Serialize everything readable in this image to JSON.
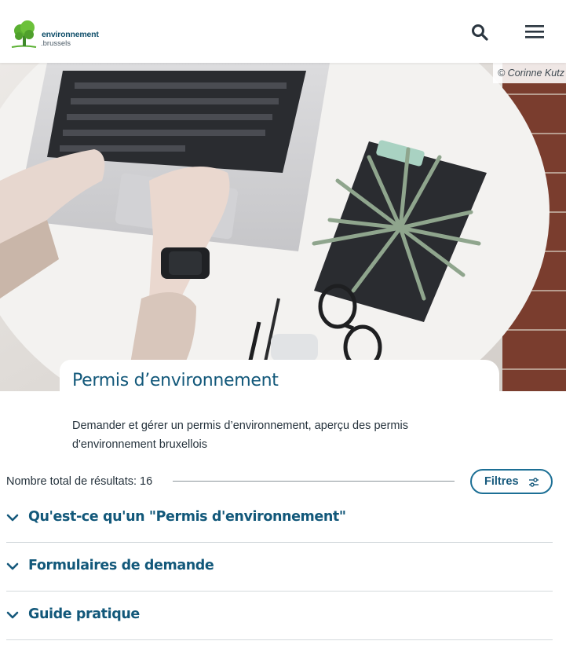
{
  "header": {
    "logo_line1": "environnement",
    "logo_line2": ".brussels",
    "search_icon": "search-icon",
    "menu_icon": "hamburger-menu-icon"
  },
  "hero": {
    "credit": "© Corinne Kutz"
  },
  "page": {
    "title": "Permis d’environnement",
    "intro": "Demander et gérer un permis d’environnement, aperçu des permis d'environnement bruxellois"
  },
  "results": {
    "count_text": "Nombre total de résultats: 16",
    "filters_label": "Filtres"
  },
  "accordion": [
    {
      "label": "Qu'est-ce qu'un \"Permis d'environnement\""
    },
    {
      "label": "Formulaires de demande"
    },
    {
      "label": "Guide pratique"
    }
  ],
  "colors": {
    "brand_blue": "#12587a",
    "button_border": "#1c6f95",
    "logo_green": "#5ab031"
  }
}
